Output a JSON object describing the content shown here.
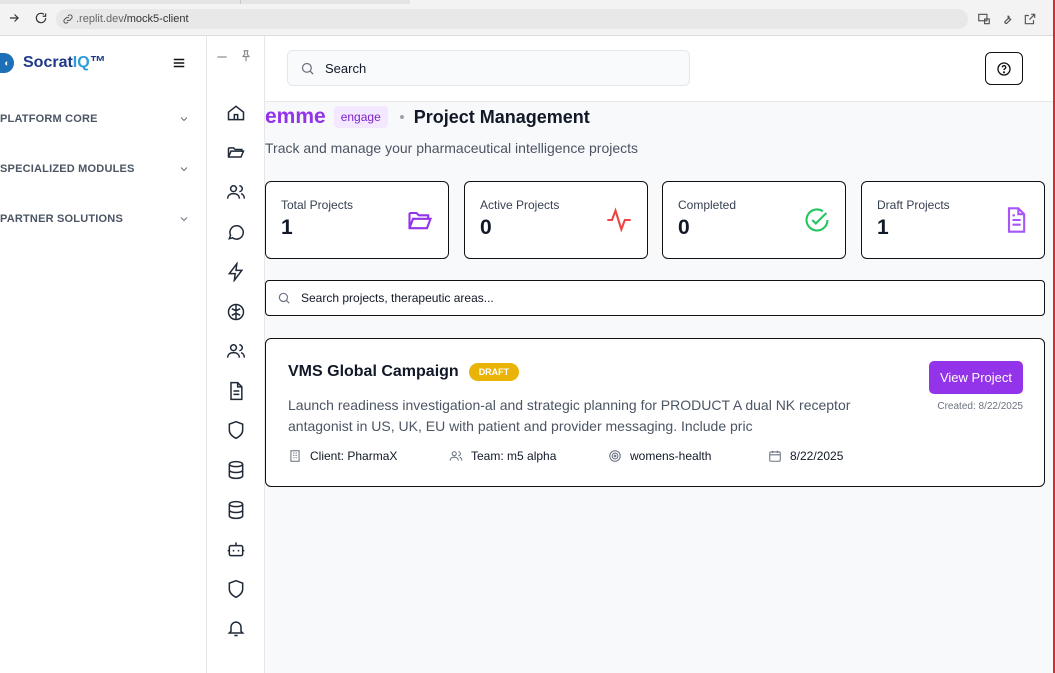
{
  "browser": {
    "url_host": ".replit.dev",
    "url_path": "/mock5-client"
  },
  "sidebar": {
    "brand_prefix": "Socrat",
    "brand_accent": "IQ",
    "brand_suffix": "™",
    "sections": [
      {
        "label": "PLATFORM CORE"
      },
      {
        "label": "SPECIALIZED MODULES"
      },
      {
        "label": "PARTNER SOLUTIONS"
      }
    ]
  },
  "header": {
    "search_placeholder": "Search"
  },
  "page": {
    "brand": "emme",
    "tag": "engage",
    "title": "Project Management",
    "subtitle": "Track and manage your pharmaceutical intelligence projects"
  },
  "stats": [
    {
      "label": "Total Projects",
      "value": "1",
      "icon": "folder-open-icon",
      "color": "#9333ea"
    },
    {
      "label": "Active Projects",
      "value": "0",
      "icon": "activity-icon",
      "color": "#ef4444"
    },
    {
      "label": "Completed",
      "value": "0",
      "icon": "check-circle-icon",
      "color": "#22c55e"
    },
    {
      "label": "Draft Projects",
      "value": "1",
      "icon": "file-text-icon",
      "color": "#a855f7"
    }
  ],
  "project_search": {
    "placeholder": "Search projects, therapeutic areas..."
  },
  "project": {
    "title": "VMS Global Campaign",
    "status": "DRAFT",
    "description": "Launch readiness investigation-al and strategic planning for PRODUCT A dual NK receptor antagonist in US, UK, EU with patient and provider messaging. Include pric",
    "view_label": "View Project",
    "created": "Created: 8/22/2025",
    "client": "Client: PharmaX",
    "team": "Team: m5 alpha",
    "area": "womens-health",
    "date": "8/22/2025"
  },
  "colors": {
    "accent": "#9333ea",
    "draft_badge": "#eab308",
    "brand_blue": "#1e3a8a",
    "brand_iq": "#2e9bdb"
  }
}
